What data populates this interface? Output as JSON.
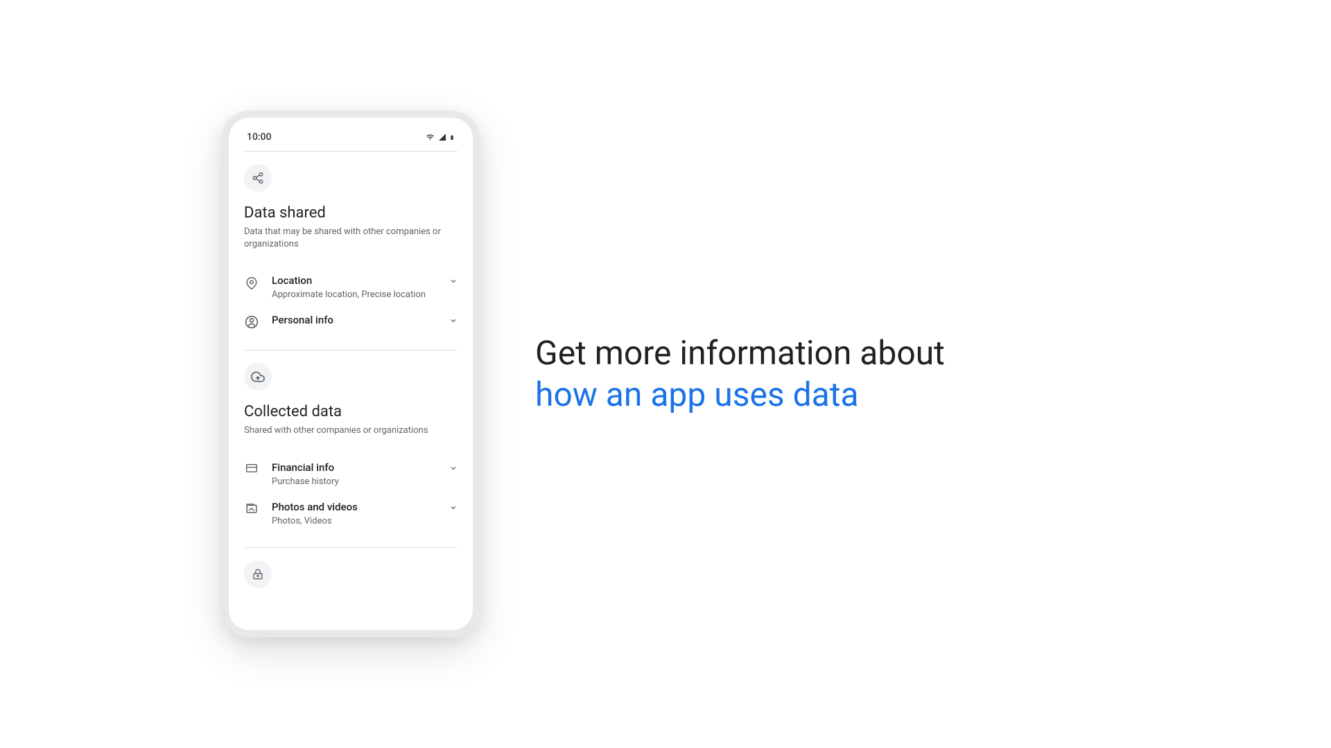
{
  "status": {
    "time": "10:00"
  },
  "sections": [
    {
      "title": "Data shared",
      "subtitle": "Data that may be shared with other companies or organizations",
      "items": [
        {
          "title": "Location",
          "detail": "Approximate location, Precise location"
        },
        {
          "title": "Personal info",
          "detail": ""
        }
      ]
    },
    {
      "title": "Collected data",
      "subtitle": "Shared with other companies or organizations",
      "items": [
        {
          "title": "Financial info",
          "detail": "Purchase history"
        },
        {
          "title": "Photos and videos",
          "detail": "Photos, Videos"
        }
      ]
    }
  ],
  "headline": {
    "line1": "Get more information about",
    "line2": "how an app uses data"
  }
}
